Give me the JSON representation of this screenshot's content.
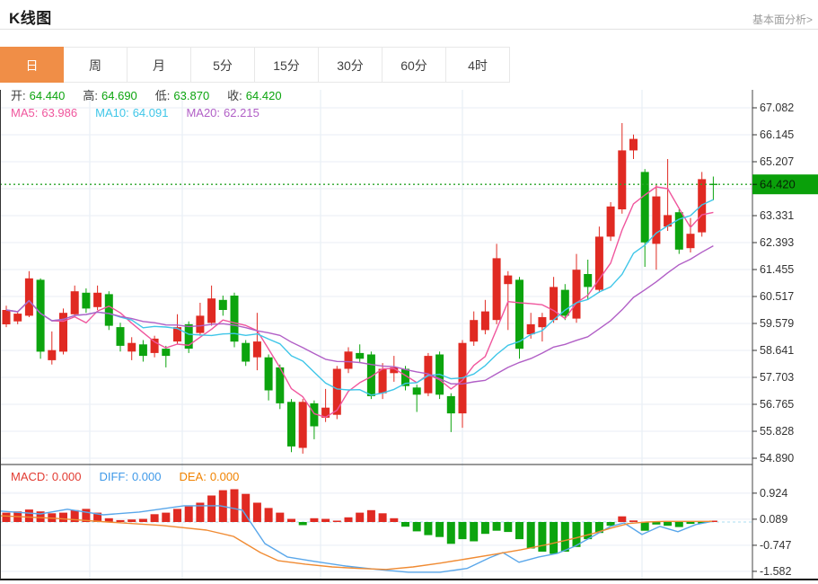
{
  "header": {
    "title": "K线图",
    "link": "基本面分析>"
  },
  "tabs": {
    "items": [
      {
        "label": "日",
        "active": true
      },
      {
        "label": "周",
        "active": false
      },
      {
        "label": "月",
        "active": false
      },
      {
        "label": "5分",
        "active": false
      },
      {
        "label": "15分",
        "active": false
      },
      {
        "label": "30分",
        "active": false
      },
      {
        "label": "60分",
        "active": false
      },
      {
        "label": "4时",
        "active": false
      }
    ]
  },
  "legend": {
    "ohlc": [
      {
        "label": "开:",
        "value": "64.440"
      },
      {
        "label": "高:",
        "value": "64.690"
      },
      {
        "label": "低:",
        "value": "63.870"
      },
      {
        "label": "收:",
        "value": "64.420"
      }
    ],
    "ma": [
      {
        "label": "MA5:",
        "value": "63.986",
        "color": "#f0569d"
      },
      {
        "label": "MA10:",
        "value": "64.091",
        "color": "#3fc6e8"
      },
      {
        "label": "MA20:",
        "value": "62.215",
        "color": "#b15fc6"
      }
    ],
    "macd": [
      {
        "label": "MACD:",
        "value": "0.000",
        "color": "#e23b31"
      },
      {
        "label": "DIFF:",
        "value": "0.000",
        "color": "#3f99e8"
      },
      {
        "label": "DEA:",
        "value": "0.000",
        "color": "#f08200"
      }
    ]
  },
  "colors": {
    "up": "#e02a22",
    "down": "#0ca40e",
    "ma5": "#f0569d",
    "ma10": "#3fc6e8",
    "ma20": "#b15fc6",
    "grid_h": "#e9eef5",
    "grid_v": "#e3ebf3",
    "axis_line": "#444444",
    "axis_text": "#333333",
    "divider": "#333333",
    "bottom_border": "#111111",
    "price_dash": "#2aa42a",
    "price_tag_bg": "#0aa00a",
    "price_tag_text": "#062206",
    "macd_zero_dash": "#aadcf2",
    "diff_line": "#5aa7ea",
    "dea_line": "#f08b33"
  },
  "chart_data": {
    "type": "candlestick",
    "title": "K线图 daily candlestick with MA5/MA10/MA20 and MACD",
    "legend_position": "top-left",
    "grid": true,
    "price_axis": {
      "side": "right",
      "ylim": [
        54.67,
        68.08
      ],
      "ticks": [
        "67.082",
        "66.145",
        "65.207",
        "63.331",
        "62.393",
        "61.455",
        "60.517",
        "59.579",
        "58.641",
        "57.703",
        "56.765",
        "55.828",
        "54.890"
      ],
      "grid_values": [
        67.082,
        66.145,
        65.207,
        64.269,
        63.331,
        62.393,
        61.455,
        60.517,
        59.579,
        58.641,
        57.703,
        56.765,
        55.828,
        54.89
      ],
      "current_price": 64.42,
      "current_price_label": "64.420"
    },
    "macd_axis": {
      "side": "right",
      "ylim": [
        -1.85,
        1.2
      ],
      "ticks": [
        "0.924",
        "0.089",
        "-0.747",
        "-1.582"
      ],
      "zero_value": 0.0
    },
    "grid_x": [
      100,
      203,
      357,
      515,
      715
    ],
    "candles": {
      "x_start": 7,
      "x_step": 12.7,
      "ohlc_order": [
        "open",
        "high",
        "low",
        "close"
      ],
      "ohlc": [
        [
          59.55,
          60.2,
          59.45,
          60.05
        ],
        [
          59.65,
          60.02,
          59.55,
          59.92
        ],
        [
          59.85,
          61.4,
          59.8,
          61.15
        ],
        [
          61.1,
          61.15,
          58.35,
          58.6
        ],
        [
          58.3,
          59.3,
          58.15,
          58.65
        ],
        [
          58.6,
          60.1,
          58.5,
          59.95
        ],
        [
          59.9,
          60.9,
          59.8,
          60.7
        ],
        [
          60.65,
          60.8,
          59.95,
          60.1
        ],
        [
          60.15,
          60.9,
          60.05,
          60.65
        ],
        [
          60.6,
          60.7,
          59.35,
          59.5
        ],
        [
          59.45,
          59.6,
          58.6,
          58.8
        ],
        [
          58.6,
          59.1,
          58.3,
          58.9
        ],
        [
          58.85,
          59.0,
          58.25,
          58.45
        ],
        [
          58.55,
          59.15,
          58.4,
          59.05
        ],
        [
          58.7,
          58.8,
          58.05,
          58.45
        ],
        [
          58.95,
          59.9,
          58.85,
          59.45
        ],
        [
          59.55,
          59.65,
          58.55,
          58.7
        ],
        [
          59.25,
          60.3,
          59.15,
          59.85
        ],
        [
          59.6,
          60.9,
          59.5,
          60.45
        ],
        [
          60.4,
          60.55,
          59.85,
          60.05
        ],
        [
          60.55,
          60.65,
          58.75,
          58.95
        ],
        [
          58.9,
          59.0,
          58.1,
          58.25
        ],
        [
          58.4,
          59.95,
          57.95,
          58.95
        ],
        [
          58.4,
          58.5,
          56.9,
          57.25
        ],
        [
          58.05,
          58.15,
          56.6,
          56.8
        ],
        [
          56.85,
          56.95,
          55.1,
          55.3
        ],
        [
          55.25,
          56.95,
          55.05,
          56.85
        ],
        [
          56.8,
          56.9,
          55.55,
          56.0
        ],
        [
          56.3,
          57.3,
          56.15,
          56.65
        ],
        [
          56.4,
          58.1,
          56.25,
          58.0
        ],
        [
          58.0,
          58.75,
          57.85,
          58.6
        ],
        [
          58.55,
          58.85,
          58.2,
          58.35
        ],
        [
          58.5,
          58.6,
          56.95,
          57.05
        ],
        [
          57.15,
          58.2,
          56.95,
          58.0
        ],
        [
          57.85,
          58.45,
          57.55,
          58.05
        ],
        [
          58.0,
          58.1,
          57.25,
          57.4
        ],
        [
          57.35,
          57.45,
          56.5,
          57.1
        ],
        [
          57.15,
          58.55,
          57.05,
          58.45
        ],
        [
          58.5,
          58.6,
          56.95,
          57.1
        ],
        [
          57.05,
          57.15,
          55.8,
          56.45
        ],
        [
          56.45,
          59.0,
          55.95,
          58.9
        ],
        [
          58.95,
          60.0,
          58.8,
          59.7
        ],
        [
          59.35,
          60.4,
          59.2,
          60.0
        ],
        [
          59.7,
          62.35,
          59.55,
          61.85
        ],
        [
          60.95,
          61.4,
          59.35,
          61.25
        ],
        [
          61.1,
          61.2,
          58.35,
          58.7
        ],
        [
          59.2,
          59.95,
          59.05,
          59.55
        ],
        [
          59.45,
          59.95,
          58.95,
          59.8
        ],
        [
          59.7,
          61.2,
          59.6,
          60.85
        ],
        [
          60.75,
          60.95,
          59.7,
          59.85
        ],
        [
          59.75,
          62.0,
          59.6,
          61.45
        ],
        [
          61.3,
          61.8,
          60.4,
          60.85
        ],
        [
          60.75,
          62.95,
          60.65,
          62.6
        ],
        [
          62.6,
          63.8,
          62.45,
          63.65
        ],
        [
          63.55,
          66.55,
          63.4,
          65.6
        ],
        [
          65.6,
          66.15,
          65.3,
          66.0
        ],
        [
          64.85,
          64.95,
          61.55,
          62.4
        ],
        [
          62.35,
          64.4,
          61.45,
          64.0
        ],
        [
          62.95,
          65.3,
          62.8,
          63.35
        ],
        [
          63.45,
          63.55,
          62.0,
          62.15
        ],
        [
          62.2,
          63.25,
          62.05,
          62.7
        ],
        [
          62.75,
          64.85,
          62.6,
          64.6
        ],
        [
          64.44,
          64.69,
          63.87,
          64.42
        ]
      ]
    },
    "ma_periods": [
      5,
      10,
      20
    ],
    "macd": {
      "histogram": [
        0.3,
        0.34,
        0.4,
        0.34,
        0.28,
        0.3,
        0.38,
        0.42,
        0.3,
        0.12,
        0.06,
        0.08,
        0.1,
        0.25,
        0.3,
        0.42,
        0.5,
        0.62,
        0.85,
        1.02,
        1.05,
        0.9,
        0.62,
        0.45,
        0.3,
        0.1,
        -0.1,
        0.12,
        0.1,
        0.03,
        0.15,
        0.3,
        0.38,
        0.28,
        0.12,
        -0.15,
        -0.3,
        -0.42,
        -0.48,
        -0.7,
        -0.55,
        -0.62,
        -0.38,
        -0.28,
        -0.32,
        -0.55,
        -0.85,
        -0.95,
        -1.02,
        -0.95,
        -0.8,
        -0.55,
        -0.35,
        -0.12,
        0.18,
        0.05,
        -0.28,
        -0.08,
        -0.12,
        -0.16,
        -0.06,
        -0.03,
        0.0
      ],
      "diff_points": [
        [
          0,
          0.35
        ],
        [
          45,
          0.26
        ],
        [
          75,
          0.41
        ],
        [
          115,
          0.23
        ],
        [
          155,
          0.32
        ],
        [
          205,
          0.52
        ],
        [
          245,
          0.52
        ],
        [
          270,
          0.38
        ],
        [
          295,
          -0.69
        ],
        [
          320,
          -1.12
        ],
        [
          350,
          -1.26
        ],
        [
          385,
          -1.41
        ],
        [
          420,
          -1.52
        ],
        [
          455,
          -1.61
        ],
        [
          490,
          -1.61
        ],
        [
          520,
          -1.49
        ],
        [
          545,
          -1.15
        ],
        [
          560,
          -0.98
        ],
        [
          578,
          -1.29
        ],
        [
          600,
          -1.12
        ],
        [
          620,
          -1.01
        ],
        [
          640,
          -0.78
        ],
        [
          660,
          -0.46
        ],
        [
          680,
          -0.14
        ],
        [
          695,
          -0.03
        ],
        [
          715,
          -0.4
        ],
        [
          735,
          -0.14
        ],
        [
          755,
          -0.31
        ],
        [
          775,
          -0.08
        ],
        [
          793,
          0.02
        ]
      ],
      "dea_points": [
        [
          0,
          0.2
        ],
        [
          60,
          0.12
        ],
        [
          120,
          0.0
        ],
        [
          180,
          -0.11
        ],
        [
          230,
          -0.26
        ],
        [
          260,
          -0.46
        ],
        [
          290,
          -0.98
        ],
        [
          310,
          -1.24
        ],
        [
          340,
          -1.35
        ],
        [
          370,
          -1.44
        ],
        [
          400,
          -1.49
        ],
        [
          430,
          -1.52
        ],
        [
          460,
          -1.44
        ],
        [
          490,
          -1.32
        ],
        [
          520,
          -1.18
        ],
        [
          550,
          -1.04
        ],
        [
          580,
          -0.89
        ],
        [
          610,
          -0.72
        ],
        [
          640,
          -0.52
        ],
        [
          660,
          -0.37
        ],
        [
          680,
          -0.2
        ],
        [
          700,
          -0.05
        ],
        [
          720,
          0.0
        ],
        [
          740,
          0.02
        ],
        [
          793,
          0.02
        ]
      ]
    }
  }
}
